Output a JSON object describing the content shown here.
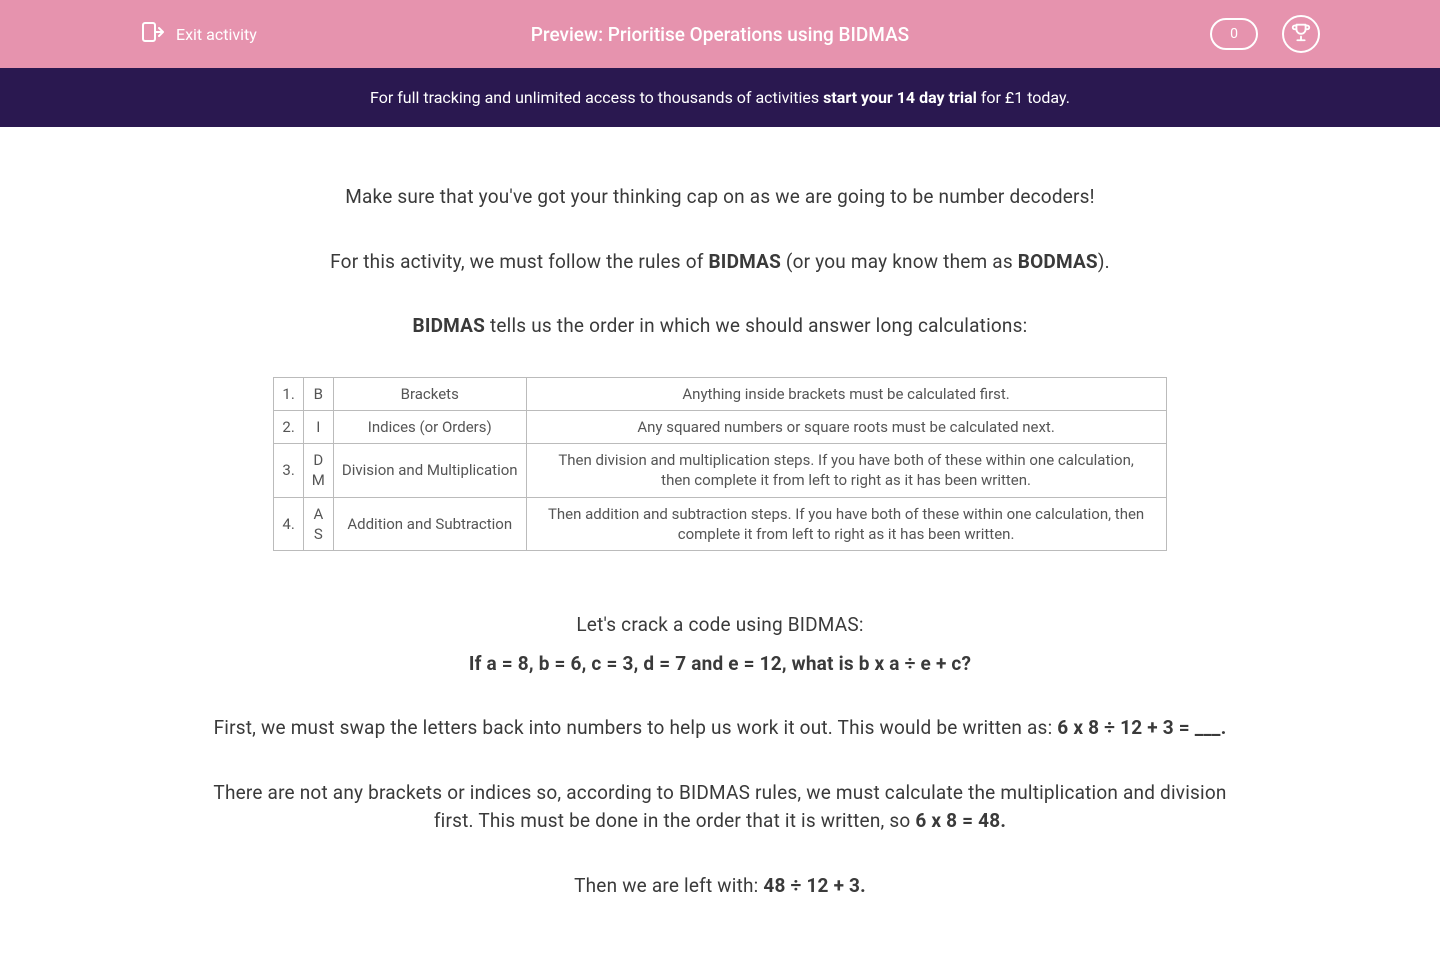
{
  "header": {
    "exit_label": "Exit activity",
    "title": "Preview: Prioritise Operations using BIDMAS",
    "score": "0"
  },
  "banner": {
    "prefix": "For full tracking and unlimited access to thousands of activities ",
    "bold": "start your 14 day trial",
    "suffix": " for £1 today."
  },
  "content": {
    "intro1": "Make sure that you've got your thinking cap on as we are going to be number decoders!",
    "intro2_prefix": "For this activity, we must follow the rules of ",
    "intro2_bidmas": "BIDMAS",
    "intro2_mid": " (or you may know them as ",
    "intro2_bodmas": "BODMAS",
    "intro2_suffix": ").",
    "intro3_bold": "BIDMAS",
    "intro3_rest": " tells us the order in which we should answer long calculations:",
    "crack": "Let's crack a code using BIDMAS:",
    "question": "If a = 8, b = 6, c = 3, d = 7 and e = 12, what is b x a ÷ e + c?",
    "swap_prefix": "First, we must swap the letters back into numbers to help us work it out. This would be written as: ",
    "swap_bold": "6 x 8 ÷ 12 + 3 = ___.",
    "explain_prefix": "There are not any brackets or indices so, according to BIDMAS rules, we must calculate the multiplication and division first. This must be done in the order that it is written, so ",
    "explain_bold": "6 x 8 = 48.",
    "left_prefix": "Then we are left with: ",
    "left_bold": "48 ÷ 12 + 3."
  },
  "table": {
    "rows": [
      {
        "num": "1.",
        "letter": "B",
        "name": "Brackets",
        "desc": "Anything inside brackets must be calculated first."
      },
      {
        "num": "2.",
        "letter": "I",
        "name": "Indices (or Orders)",
        "desc": "Any squared numbers or square roots must be calculated next."
      },
      {
        "num": "3.",
        "letter": "D\nM",
        "name": "Division and Multiplication",
        "desc": "Then division and multiplication steps. If you have both of these within one calculation, then complete it from left to right as it has been written."
      },
      {
        "num": "4.",
        "letter": "A\nS",
        "name": "Addition and Subtraction",
        "desc": "Then addition and subtraction steps. If you have both of these within one calculation, then complete it from left to right as it has been written."
      }
    ]
  }
}
